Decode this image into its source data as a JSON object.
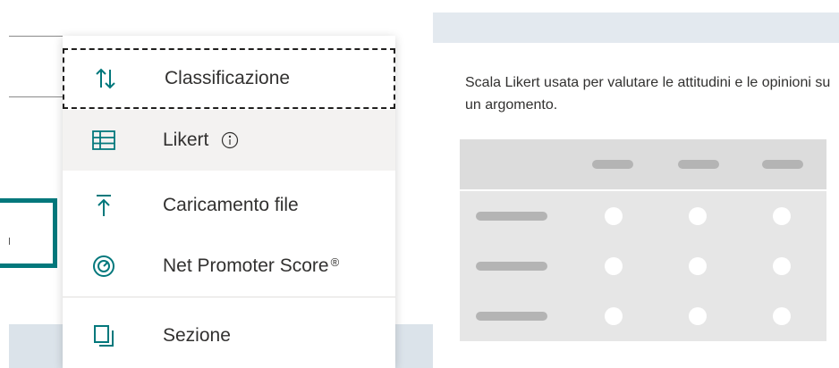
{
  "menu": {
    "items": [
      {
        "label": "Classificazione",
        "icon": "sort-arrows-icon"
      },
      {
        "label": "Likert",
        "icon": "grid-table-icon",
        "info_icon": "info-icon"
      },
      {
        "label": "Caricamento file",
        "icon": "upload-arrow-icon"
      },
      {
        "label": "Net Promoter Score",
        "suffix": "®",
        "icon": "gauge-icon"
      },
      {
        "label": "Sezione",
        "icon": "section-pages-icon"
      }
    ]
  },
  "preview": {
    "description": "Scala Likert usata per valutare le attitudini e le opinioni su un argomento."
  },
  "colors": {
    "accent": "#03787c",
    "selected_bg": "#f3f2f1",
    "text": "#323130"
  }
}
